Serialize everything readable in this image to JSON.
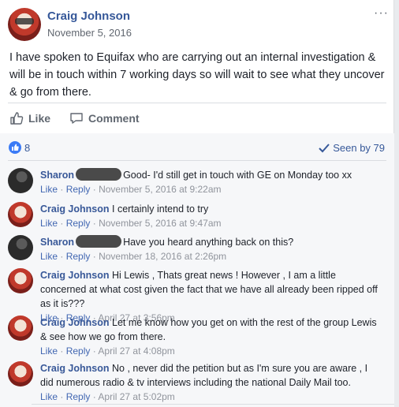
{
  "post": {
    "author": "Craig Johnson",
    "date": "November 5, 2016",
    "more_label": "···",
    "text": "I have spoken to Equifax who are carrying out an internal investigation & will be in touch within 7 working days so will wait to see what they uncover & go from there."
  },
  "actions": {
    "like_label": "Like",
    "comment_label": "Comment"
  },
  "reactions": {
    "like_count": "8",
    "seen_label": "Seen by 79"
  },
  "comments": [
    {
      "author": "Sharon",
      "redacted": true,
      "text": "Good- I'd still get in touch with GE on Monday too xx",
      "like": "Like",
      "reply": "Reply",
      "sep": "·",
      "time": "November 5, 2016 at 9:22am"
    },
    {
      "author": "Craig Johnson",
      "redacted": false,
      "text": "I certainly intend to try",
      "like": "Like",
      "reply": "Reply",
      "sep": "·",
      "time": "November 5, 2016 at 9:47am"
    },
    {
      "author": "Sharon",
      "redacted": true,
      "text": "Have you heard anything back on this?",
      "like": "Like",
      "reply": "Reply",
      "sep": "·",
      "time": "November 18, 2016 at 2:26pm"
    },
    {
      "author": "Craig Johnson",
      "redacted": false,
      "text": "Hi Lewis , Thats great news ! However , I am a little concerned at what cost given the fact that we have all already been ripped off as it is???",
      "like": "Like",
      "reply": "Reply",
      "sep": "·",
      "time": "April 27 at 3:56pm"
    },
    {
      "author": "Craig Johnson",
      "redacted": false,
      "text": "Let me know how you get on with the rest of the group Lewis & see how we go from there.",
      "like": "Like",
      "reply": "Reply",
      "sep": "·",
      "time": "April 27 at 4:08pm"
    },
    {
      "author": "Craig Johnson",
      "redacted": false,
      "text": "No , never did the petition but as I'm sure you are aware , I did numerous radio & tv interviews including the national Daily Mail too.",
      "like": "Like",
      "reply": "Reply",
      "sep": "·",
      "time": "April 27 at 5:02pm"
    }
  ],
  "colors": {
    "link_blue": "#365899",
    "meta_gray": "#90949c",
    "like_badge": "#3b7bf6"
  }
}
